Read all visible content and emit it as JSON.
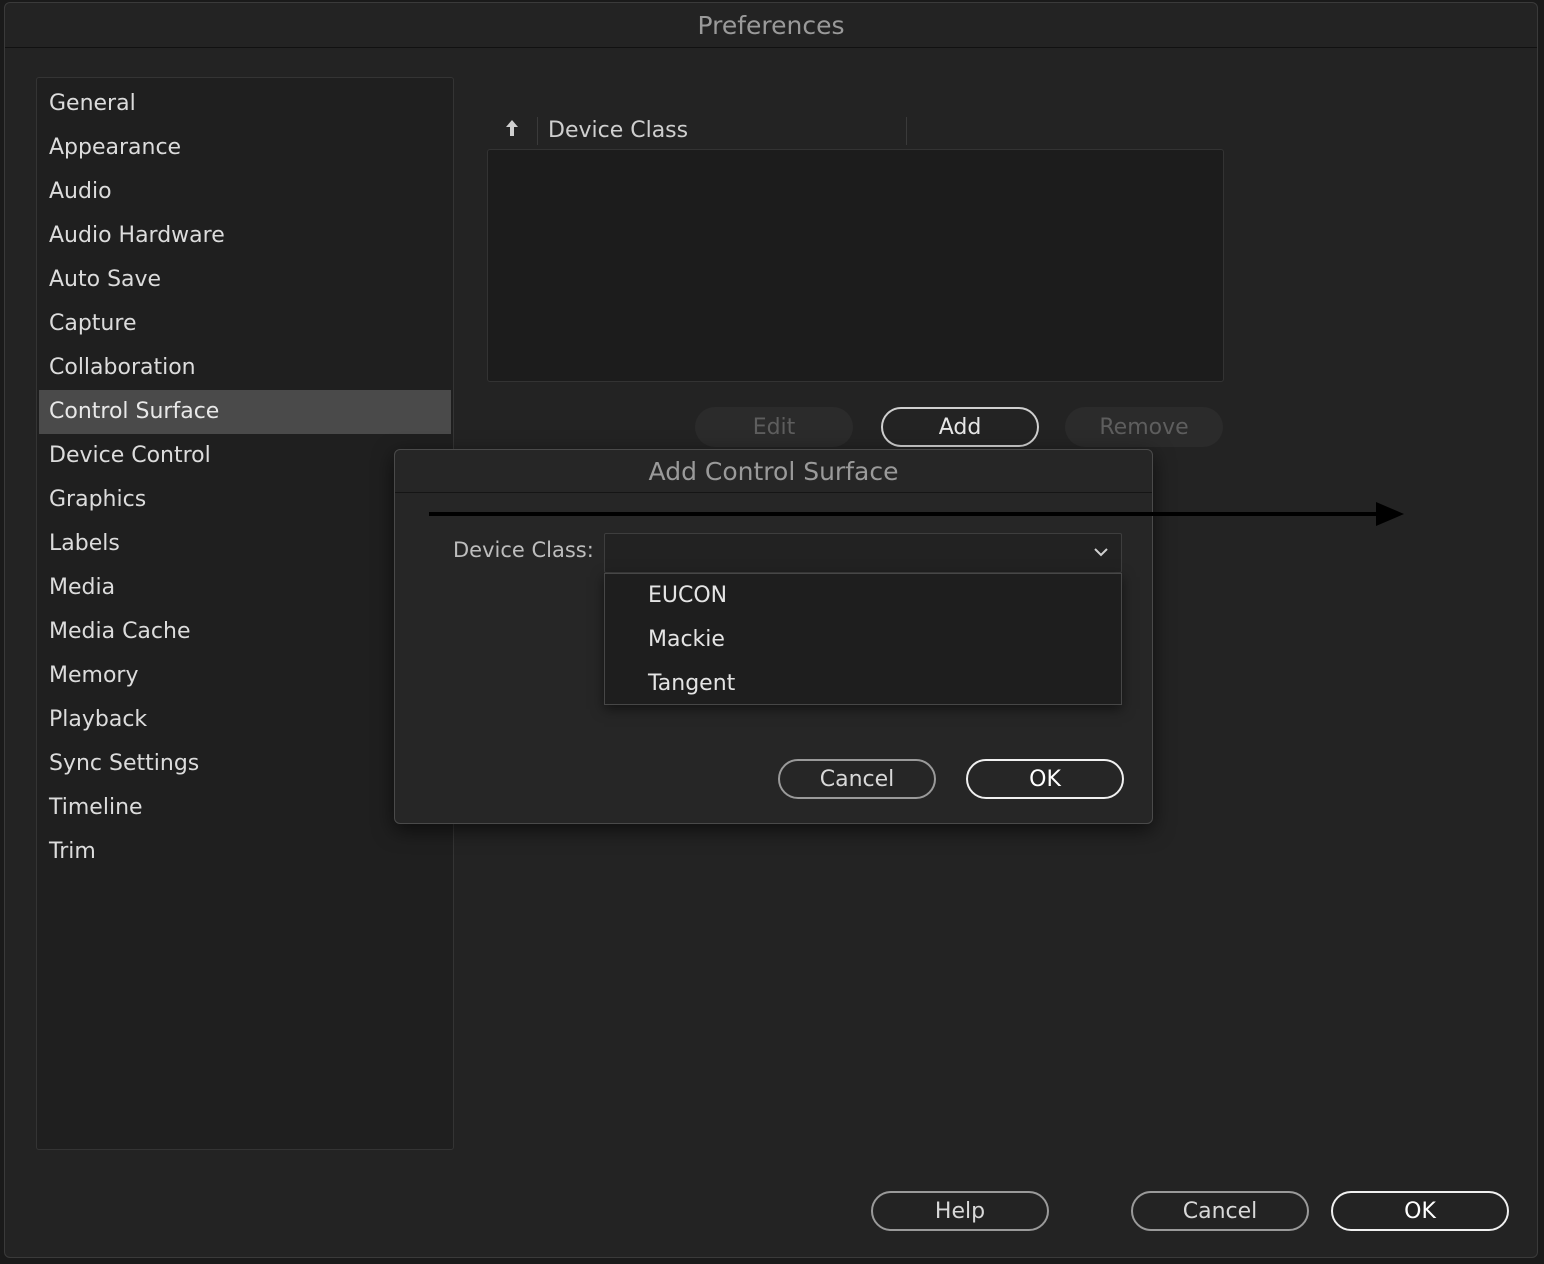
{
  "window": {
    "title": "Preferences"
  },
  "sidebar": {
    "items": [
      {
        "label": "General"
      },
      {
        "label": "Appearance"
      },
      {
        "label": "Audio"
      },
      {
        "label": "Audio Hardware"
      },
      {
        "label": "Auto Save"
      },
      {
        "label": "Capture"
      },
      {
        "label": "Collaboration"
      },
      {
        "label": "Control Surface",
        "selected": true
      },
      {
        "label": "Device Control"
      },
      {
        "label": "Graphics"
      },
      {
        "label": "Labels"
      },
      {
        "label": "Media"
      },
      {
        "label": "Media Cache"
      },
      {
        "label": "Memory"
      },
      {
        "label": "Playback"
      },
      {
        "label": "Sync Settings"
      },
      {
        "label": "Timeline"
      },
      {
        "label": "Trim"
      }
    ]
  },
  "control_surface": {
    "column_header": "Device Class",
    "sort_icon": "arrow-up-icon",
    "edit_label": "Edit",
    "add_label": "Add",
    "remove_label": "Remove"
  },
  "dialog": {
    "title": "Add Control Surface",
    "field_label": "Device Class:",
    "selected_value": "",
    "options": [
      "EUCON",
      "Mackie",
      "Tangent"
    ],
    "cancel_label": "Cancel",
    "ok_label": "OK"
  },
  "footer": {
    "help_label": "Help",
    "cancel_label": "Cancel",
    "ok_label": "OK"
  }
}
